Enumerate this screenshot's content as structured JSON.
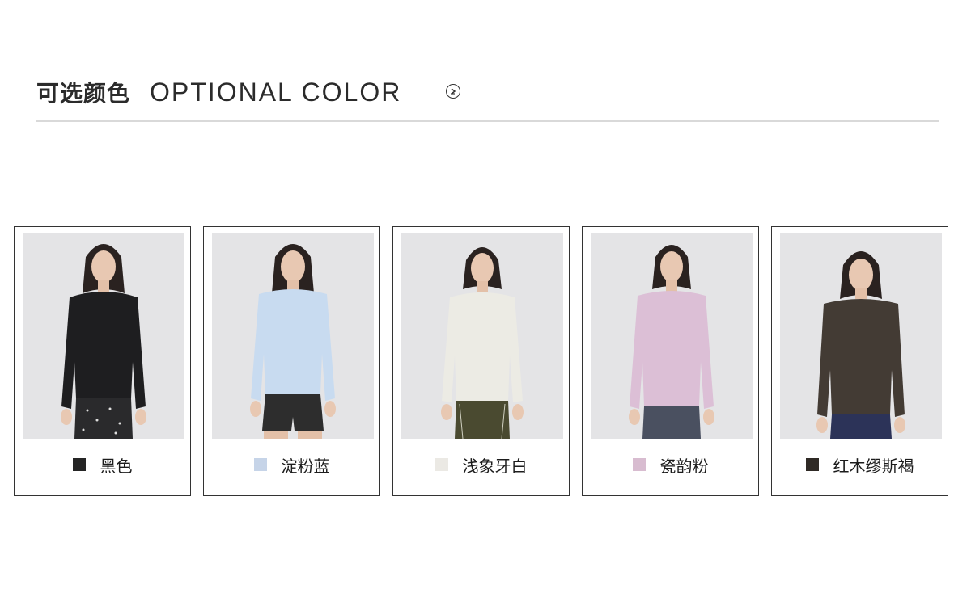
{
  "header": {
    "title_cn": "可选颜色",
    "title_en": "OPTIONAL COLOR",
    "arrow_icon": "chevron-right-circle-icon"
  },
  "colors": [
    {
      "name": "黑色",
      "swatch": "#252525",
      "shirt": "#1e1e20",
      "bottom": "#2a2a2c"
    },
    {
      "name": "淀粉蓝",
      "swatch": "#c6d4e8",
      "shirt": "#c8dbf0",
      "bottom": "#2d2d2d"
    },
    {
      "name": "浅象牙白",
      "swatch": "#ebe9e4",
      "shirt": "#ecebe4",
      "bottom": "#4a4a30"
    },
    {
      "name": "瓷韵粉",
      "swatch": "#d8bcd0",
      "shirt": "#dcbfd6",
      "bottom": "#4a5060"
    },
    {
      "name": "红木缪斯褐",
      "swatch": "#2f2a25",
      "shirt": "#433b34",
      "bottom": "#2c3358"
    }
  ]
}
